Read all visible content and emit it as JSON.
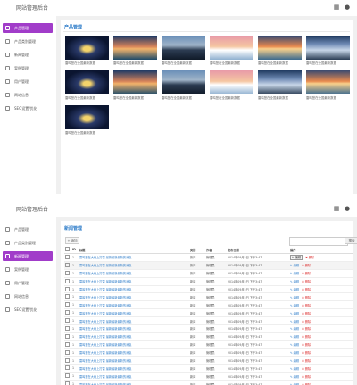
{
  "app": {
    "brand": "网站管理后台"
  },
  "topbar_icons": [
    "grid-icon",
    "user-icon"
  ],
  "nav": {
    "items": [
      {
        "key": "products",
        "label": "产品管理",
        "icon": "box-icon"
      },
      {
        "key": "product-category",
        "label": "产品类别管理",
        "icon": "list-icon"
      },
      {
        "key": "news",
        "label": "新闻管理",
        "icon": "doc-icon"
      },
      {
        "key": "case",
        "label": "案例管理",
        "icon": "image-icon"
      },
      {
        "key": "users",
        "label": "用户管理",
        "icon": "user-icon"
      },
      {
        "key": "site-info",
        "label": "网站信息",
        "icon": "pin-icon"
      },
      {
        "key": "seo",
        "label": "SEO设置/优化",
        "icon": "gear-icon"
      }
    ],
    "active_view1": "products",
    "active_view2": "news"
  },
  "view1": {
    "title": "产品管理",
    "items": [
      {
        "caption": "雷鸣登在全国最新数据",
        "thumb": "tunnel"
      },
      {
        "caption": "雷鸣登在全国最新数据",
        "thumb": "sunset"
      },
      {
        "caption": "雷鸣登在全国最新数据",
        "thumb": "city"
      },
      {
        "caption": "雷鸣登在全国最新数据",
        "thumb": "pink"
      },
      {
        "caption": "雷鸣登在全国最新数据",
        "thumb": "orange"
      },
      {
        "caption": "雷鸣登在全国最新数据",
        "thumb": "peak"
      },
      {
        "caption": "雷鸣登在全国最新数据",
        "thumb": "tunnel"
      },
      {
        "caption": "雷鸣登在全国最新数据",
        "thumb": "sunset"
      },
      {
        "caption": "雷鸣登在全国最新数据",
        "thumb": "city"
      },
      {
        "caption": "雷鸣登在全国最新数据",
        "thumb": "pink"
      },
      {
        "caption": "雷鸣登在全国最新数据",
        "thumb": "peak"
      },
      {
        "caption": "雷鸣登在全国最新数据",
        "thumb": "orange"
      },
      {
        "caption": "雷鸣登在全国最新数据",
        "thumb": "tunnel"
      }
    ]
  },
  "view2": {
    "title": "新闻管理",
    "add_button": "+ 添加",
    "search_button": "搜索",
    "search_placeholder": "",
    "columns": [
      "",
      "ID",
      "标题",
      "类别",
      "作者",
      "发布日期",
      "操作"
    ],
    "rows": [
      {
        "id": "1",
        "title": "雷鸣登在大雨上打雷 最新最新最新的消息",
        "category": "新闻",
        "author": "管理员",
        "date": "2014年09月5日 下午3:47"
      },
      {
        "id": "1",
        "title": "雷鸣登在大雨上打雷 最新最新最新的消息",
        "category": "新闻",
        "author": "管理员",
        "date": "2014年09月5日 下午3:47"
      },
      {
        "id": "1",
        "title": "雷鸣登在大雨上打雷 最新最新最新的消息",
        "category": "新闻",
        "author": "管理员",
        "date": "2014年09月5日 下午3:47"
      },
      {
        "id": "1",
        "title": "雷鸣登在大雨上打雷 最新最新最新的消息",
        "category": "新闻",
        "author": "管理员",
        "date": "2014年09月5日 下午3:47"
      },
      {
        "id": "1",
        "title": "雷鸣登在大雨上打雷 最新最新最新的消息",
        "category": "新闻",
        "author": "管理员",
        "date": "2014年09月5日 下午3:47"
      },
      {
        "id": "1",
        "title": "雷鸣登在大雨上打雷 最新最新最新的消息",
        "category": "新闻",
        "author": "管理员",
        "date": "2014年09月5日 下午3:47"
      },
      {
        "id": "1",
        "title": "雷鸣登在大雨上打雷 最新最新最新的消息",
        "category": "新闻",
        "author": "管理员",
        "date": "2014年09月5日 下午3:47"
      },
      {
        "id": "1",
        "title": "雷鸣登在大雨上打雷 最新最新最新的消息",
        "category": "新闻",
        "author": "管理员",
        "date": "2014年09月5日 下午3:47"
      },
      {
        "id": "1",
        "title": "雷鸣登在大雨上打雷 最新最新最新的消息",
        "category": "新闻",
        "author": "管理员",
        "date": "2014年09月5日 下午3:47"
      },
      {
        "id": "1",
        "title": "雷鸣登在大雨上打雷 最新最新最新的消息",
        "category": "新闻",
        "author": "管理员",
        "date": "2014年09月5日 下午3:47"
      },
      {
        "id": "1",
        "title": "雷鸣登在大雨上打雷 最新最新最新的消息",
        "category": "新闻",
        "author": "管理员",
        "date": "2014年09月5日 下午3:47"
      },
      {
        "id": "1",
        "title": "雷鸣登在大雨上打雷 最新最新最新的消息",
        "category": "新闻",
        "author": "管理员",
        "date": "2014年09月5日 下午3:47"
      },
      {
        "id": "1",
        "title": "雷鸣登在大雨上打雷 最新最新最新的消息",
        "category": "新闻",
        "author": "管理员",
        "date": "2014年09月5日 下午3:47"
      },
      {
        "id": "1",
        "title": "雷鸣登在大雨上打雷 最新最新最新的消息",
        "category": "新闻",
        "author": "管理员",
        "date": "2014年09月5日 下午3:47"
      },
      {
        "id": "1",
        "title": "雷鸣登在大雨上打雷 最新最新最新的消息",
        "category": "新闻",
        "author": "管理员",
        "date": "2014年09月5日 下午3:47"
      },
      {
        "id": "1",
        "title": "雷鸣登在大雨上打雷 最新最新最新的消息",
        "category": "新闻",
        "author": "管理员",
        "date": "2014年09月5日 下午3:47"
      },
      {
        "id": "1",
        "title": "雷鸣登在大雨上打雷 最新最新最新的消息",
        "category": "新闻",
        "author": "管理员",
        "date": "2014年09月5日 下午3:47"
      },
      {
        "id": "1",
        "title": "雷鸣登在大雨上打雷 最新最新最新的消息",
        "category": "新闻",
        "author": "管理员",
        "date": "2014年09月5日 下午3:47"
      }
    ],
    "actions": {
      "edit": "✎ 编辑",
      "delete": "✖ 删除"
    },
    "highlight_row": 1
  },
  "colors": {
    "accent": "#a13cc9",
    "link": "#2f7dc9",
    "danger": "#dd3333"
  }
}
